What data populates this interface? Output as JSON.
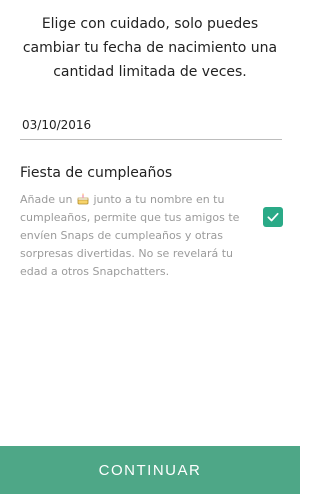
{
  "header": {
    "message": "Elige con cuidado, solo puedes cambiar tu fecha de nacimiento una cantidad limitada de veces."
  },
  "birthday_field": {
    "value": "03/10/2016"
  },
  "birthday_party": {
    "title": "Fiesta de cumpleaños",
    "description_before_icon": "Añade un ",
    "description_after_icon": " junto a tu nombre en tu cumpleaños, permite que tus amigos te envíen Snaps de cumpleaños y otras sorpresas divertidas. No se revelará tu edad a otros Snapchatters.",
    "icon": "cake-icon",
    "checked": true
  },
  "footer": {
    "continue_label": "CONTINUAR"
  },
  "colors": {
    "accent": "#2aaa87",
    "footer": "#4ea787",
    "muted_text": "#9b9b9b"
  }
}
